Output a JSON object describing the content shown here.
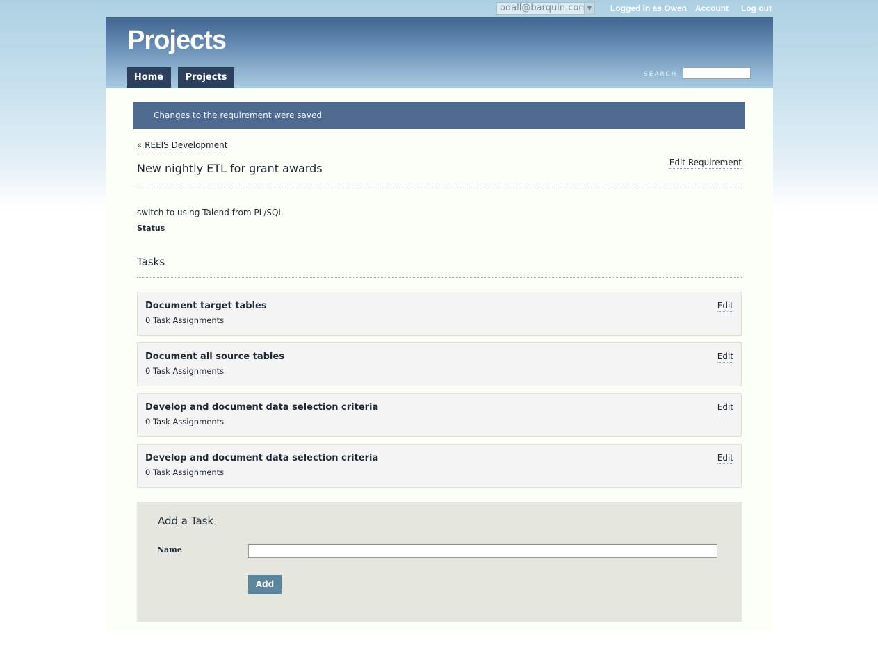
{
  "topbar": {
    "account_email": "odall@barquin.com",
    "logged_in": "Logged in as Owen",
    "account": "Account",
    "logout": "Log out"
  },
  "header": {
    "title": "Projects",
    "nav": [
      {
        "label": "Home"
      },
      {
        "label": "Projects"
      }
    ],
    "search_label": "SEARCH",
    "search_value": ""
  },
  "flash": "Changes to the requirement were saved",
  "requirement": {
    "back": "« REEIS Development",
    "title": "New nightly ETL for grant awards",
    "edit": "Edit Requirement",
    "description": "switch to using Talend from PL/SQL",
    "status_label": "Status"
  },
  "tasks": {
    "heading": "Tasks",
    "items": [
      {
        "name": "Document target tables",
        "assignments": "0 Task Assignments",
        "edit": "Edit"
      },
      {
        "name": "Document all source tables",
        "assignments": "0 Task Assignments",
        "edit": "Edit"
      },
      {
        "name": "Develop and document data selection criteria",
        "assignments": "0 Task Assignments",
        "edit": "Edit"
      },
      {
        "name": "Develop and document data selection criteria",
        "assignments": "0 Task Assignments",
        "edit": "Edit"
      }
    ]
  },
  "add_task": {
    "title": "Add a Task",
    "name_label": "Name",
    "name_value": "",
    "button": "Add"
  }
}
